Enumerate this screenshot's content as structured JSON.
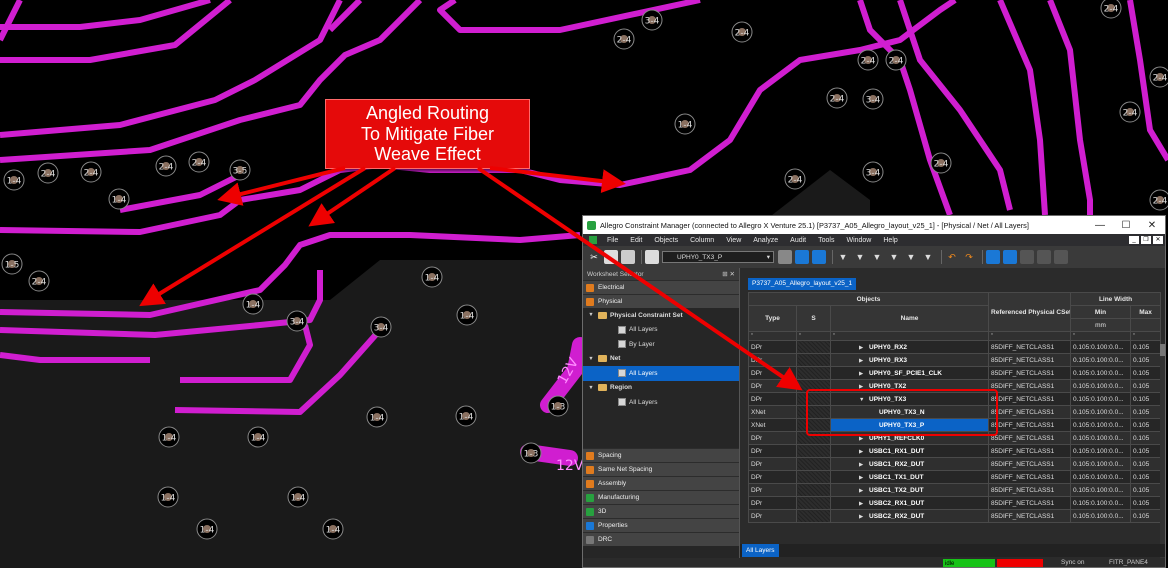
{
  "pcb": {
    "callout_lines": [
      "Angled Routing",
      "To Mitigate Fiber",
      "Weave Effect"
    ],
    "via_labels": {
      "v_3_4_top": "3-4",
      "v_2_4_a": "2-4",
      "v_2_4_b": "2-4",
      "v_2_4_c": "2-4",
      "v_2_4_d": "2-4",
      "v_2_4_e": "2-4",
      "v_2_4_f": "2-4",
      "v_3_4_mid": "3-4",
      "v_1_4_a": "1-4",
      "v_2_4_g": "2-4",
      "v_2_4_h": "2-4",
      "v_2_4_i": "2-4",
      "v_3_5": "3-5",
      "v_1_4_b": "1-4",
      "v_2_4_j": "2-4",
      "v_2_4_k": "2-4",
      "v_2_4_l": "2-4",
      "v_3_4_r": "3-4",
      "v_2_4_m": "2-4",
      "v_1_5": "1-5",
      "v_2_4_n": "2-4",
      "v_1_4_c": "1-4",
      "v_1_4_d": "1-4",
      "v_3_4_l": "3-4",
      "v_3_4_l2": "3-4",
      "v_1_4_e": "1-4",
      "v_1_4_f": "1-4",
      "v_1_4_g": "1-4",
      "v_1_4_h": "1-4",
      "v_1_4_i": "1-4",
      "v_1_4_j": "1-4",
      "v_1_3_a": "1-3",
      "v_1_3_b": "1-3",
      "v_1_4_k": "1-4",
      "v_1_4_l": "1-4",
      "v_1_4_m": "1-4",
      "v_1_4_n": "1-4",
      "v_2_4_o": "2-4",
      "v_2_4_p": "2-4"
    },
    "net_labels": [
      "12V",
      "12V"
    ]
  },
  "window": {
    "title": "Allegro Constraint Manager (connected to Allegro X Venture 25.1) [P3737_A05_Allegro_layout_v25_1] - [Physical / Net / All Layers]",
    "menu": [
      "File",
      "Edit",
      "Objects",
      "Column",
      "View",
      "Analyze",
      "Audit",
      "Tools",
      "Window",
      "Help"
    ],
    "net_select": "UPHY0_TX3_P",
    "browser": {
      "title": "Worksheet Selector",
      "categories_top": [
        "Electrical",
        "Physical"
      ],
      "tree": [
        {
          "label": "Physical Constraint Set",
          "level": 0,
          "kind": "folder",
          "bold": true
        },
        {
          "label": "All Layers",
          "level": 1,
          "kind": "sheet"
        },
        {
          "label": "By Layer",
          "level": 1,
          "kind": "sheet"
        },
        {
          "label": "Net",
          "level": 0,
          "kind": "folder",
          "bold": true
        },
        {
          "label": "All Layers",
          "level": 1,
          "kind": "sheet",
          "selected": true
        },
        {
          "label": "Region",
          "level": 0,
          "kind": "folder",
          "bold": true
        },
        {
          "label": "All Layers",
          "level": 1,
          "kind": "sheet"
        }
      ],
      "categories_bottom": [
        "Spacing",
        "Same Net Spacing",
        "Assembly",
        "Manufacturing",
        "3D",
        "Properties",
        "DRC"
      ]
    },
    "doc_tab": "P3737_A05_Allegro_layout_v25_1",
    "grid": {
      "group_objects": "Objects",
      "col_type": "Type",
      "col_s": "S",
      "col_name": "Name",
      "col_cset": "Referenced Physical CSet",
      "group_line_width": "Line Width",
      "col_min": "Min",
      "col_max": "Max",
      "unit": "mm",
      "rows": [
        {
          "type": "DPr",
          "name": "UPHY0_RX2",
          "tri": "▶",
          "cset": "85DIFF_NETCLASS1",
          "min": "0.105:0.100:0.0...",
          "max": "0.105"
        },
        {
          "type": "DPr",
          "name": "UPHY0_RX3",
          "tri": "▶",
          "cset": "85DIFF_NETCLASS1",
          "min": "0.105:0.100:0.0...",
          "max": "0.105"
        },
        {
          "type": "DPr",
          "name": "UPHY0_SF_PCIE1_CLK",
          "tri": "▶",
          "cset": "85DIFF_NETCLASS1",
          "min": "0.105:0.100:0.0...",
          "max": "0.105"
        },
        {
          "type": "DPr",
          "name": "UPHY0_TX2",
          "tri": "▶",
          "cset": "85DIFF_NETCLASS1",
          "min": "0.105:0.100:0.0...",
          "max": "0.105"
        },
        {
          "type": "DPr",
          "name": "UPHY0_TX3",
          "tri": "▼",
          "cset": "85DIFF_NETCLASS1",
          "min": "0.105:0.100:0.0...",
          "max": "0.105"
        },
        {
          "type": "XNet",
          "name": "UPHY0_TX3_N",
          "tri": "",
          "cset": "85DIFF_NETCLASS1",
          "min": "0.105:0.100:0.0...",
          "max": "0.105"
        },
        {
          "type": "XNet",
          "name": "UPHY0_TX3_P",
          "tri": "",
          "cset": "85DIFF_NETCLASS1",
          "min": "0.105:0.100:0.0...",
          "max": "0.105",
          "selected": true
        },
        {
          "type": "DPr",
          "name": "UPHY1_REFCLK0",
          "tri": "▶",
          "cset": "85DIFF_NETCLASS1",
          "min": "0.105:0.100:0.0...",
          "max": "0.105"
        },
        {
          "type": "DPr",
          "name": "USBC1_RX1_DUT",
          "tri": "▶",
          "cset": "85DIFF_NETCLASS1",
          "min": "0.105:0.100:0.0...",
          "max": "0.105"
        },
        {
          "type": "DPr",
          "name": "USBC1_RX2_DUT",
          "tri": "▶",
          "cset": "85DIFF_NETCLASS1",
          "min": "0.105:0.100:0.0...",
          "max": "0.105"
        },
        {
          "type": "DPr",
          "name": "USBC1_TX1_DUT",
          "tri": "▶",
          "cset": "85DIFF_NETCLASS1",
          "min": "0.105:0.100:0.0...",
          "max": "0.105"
        },
        {
          "type": "DPr",
          "name": "USBC1_TX2_DUT",
          "tri": "▶",
          "cset": "85DIFF_NETCLASS1",
          "min": "0.105:0.100:0.0...",
          "max": "0.105"
        },
        {
          "type": "DPr",
          "name": "USBC2_RX1_DUT",
          "tri": "▶",
          "cset": "85DIFF_NETCLASS1",
          "min": "0.105:0.100:0.0...",
          "max": "0.105"
        },
        {
          "type": "DPr",
          "name": "USBC2_RX2_DUT",
          "tri": "▶",
          "cset": "85DIFF_NETCLASS1",
          "min": "0.105:0.100:0.0...",
          "max": "0.105"
        }
      ]
    },
    "bottom_tab": "All Layers",
    "status": {
      "green_text": "idle",
      "sync": "Sync on",
      "pane": "FITR_PANE4"
    }
  }
}
